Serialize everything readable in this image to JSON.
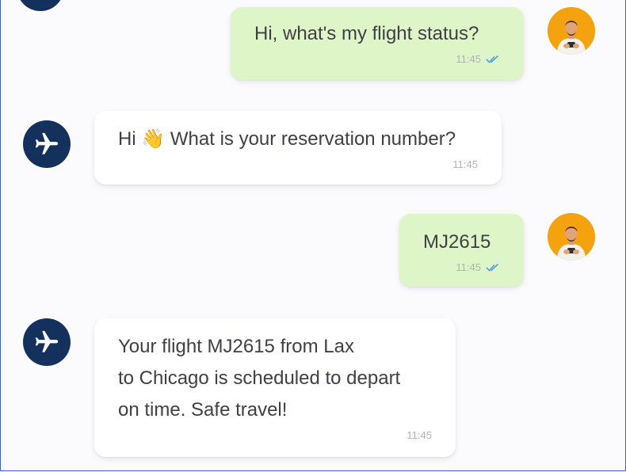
{
  "conversation": {
    "messages": [
      {
        "sender": "user",
        "text": "Hi, what's my flight status?",
        "time": "11:45",
        "read_icon": "double-check-icon"
      },
      {
        "sender": "bot",
        "text": "Hi 👋 What is your reservation number?",
        "time": "11:45"
      },
      {
        "sender": "user",
        "text": "MJ2615",
        "time": "11:45",
        "read_icon": "double-check-icon"
      },
      {
        "sender": "bot",
        "text": "Your flight MJ2615 from Lax\nto Chicago is scheduled to depart\non time. Safe travel!",
        "time": "11:45"
      }
    ]
  },
  "colors": {
    "user_bubble": "#def5c8",
    "bot_bubble": "#ffffff",
    "bot_avatar": "#13315c",
    "user_avatar": "#f5a20f",
    "read_ticks": "#4aa3df"
  },
  "icons": {
    "bot_avatar": "airplane-icon",
    "user_avatar": "user-photo-icon"
  }
}
